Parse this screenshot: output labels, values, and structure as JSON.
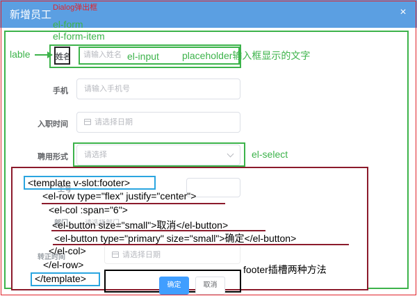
{
  "dialog": {
    "title": "新增员工",
    "close_glyph": "×",
    "annotation": "Dialog弹出框"
  },
  "annotations": {
    "el_form": "el-form",
    "el_form_item": "el-form-item",
    "lable": "lable",
    "el_input": "el-input",
    "placeholder": "placeholder输入框显示的文字",
    "el_select": "el-select",
    "footer_note": "footer插槽两种方法"
  },
  "form": {
    "name": {
      "label": "姓名",
      "placeholder": "请输入姓名"
    },
    "phone": {
      "label": "手机",
      "placeholder": "请输入手机号"
    },
    "hire_date": {
      "label": "入职时间",
      "placeholder": "请选择日期"
    },
    "employment": {
      "label": "聘用形式",
      "placeholder": "请选择"
    },
    "hidden_label_1": "工号",
    "hidden_label_2": "部门",
    "hidden_dept_placeholder": "请选择部门",
    "regular_date": {
      "label": "转正时间",
      "placeholder": "请选择日期"
    }
  },
  "code": {
    "line1": "<template v-slot:footer>",
    "line2": "<el-row type=\"flex\" justify=\"center\">",
    "line3": "<el-col :span=\"6\">",
    "line4": "<el-button size=\"small\">取消</el-button>",
    "line5": "<el-button type=\"primary\" size=\"small\">确定</el-button>",
    "line6": "</el-col>",
    "line7": "</el-row>",
    "line8": "</template>"
  },
  "footer": {
    "confirm_label": "确定",
    "cancel_label": "取消"
  },
  "colors": {
    "header": "#5b9fe2",
    "annotation_green": "#3cb34a",
    "annotation_red": "#e0242c",
    "code_border": "#8b1a2b",
    "blue_box": "#2aa5e0",
    "primary_button": "#409eff"
  }
}
